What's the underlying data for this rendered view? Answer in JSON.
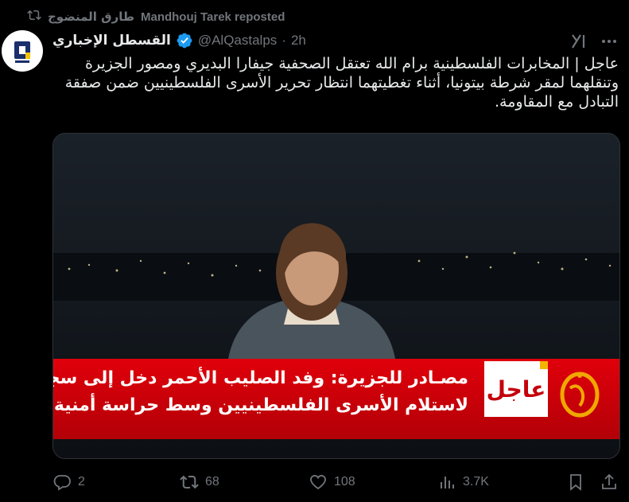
{
  "repost": {
    "reposter_name": "طارق المنضوج",
    "label": "Mandhouj Tarek reposted"
  },
  "author": {
    "name": "القسطل الإخباري",
    "handle": "@AlQastalps",
    "separator": "·",
    "time": "2h"
  },
  "tweet": {
    "text": "عاجل | المخابرات الفلسطينية برام الله تعتقل الصحفية جيفارا البديري ومصور الجزيرة وتنقلهما لمقر شرطة بيتونيا، أثناء تغطيتهما انتظار تحرير الأسرى الفلسطينيين ضمن صفقة التبادل مع المقاومة."
  },
  "media": {
    "breaking_label": "عاجل",
    "ticker_line1": "مصـادر للجزيرة: وفد الصليب الأحمر دخل إلى سجن عوفر",
    "ticker_line2": "لاستلام الأسرى الفلسطينيين وسط حراسة أمنية مشددة",
    "colors": {
      "ticker_red": "#d6000a",
      "corner_yellow": "#f5b400"
    }
  },
  "actions": {
    "replies": "2",
    "reposts": "68",
    "likes": "108",
    "views": "3.7K"
  },
  "colors": {
    "background": "#000000",
    "text": "#e7e9ea",
    "muted": "#71767b",
    "verified": "#1d9bf0"
  }
}
